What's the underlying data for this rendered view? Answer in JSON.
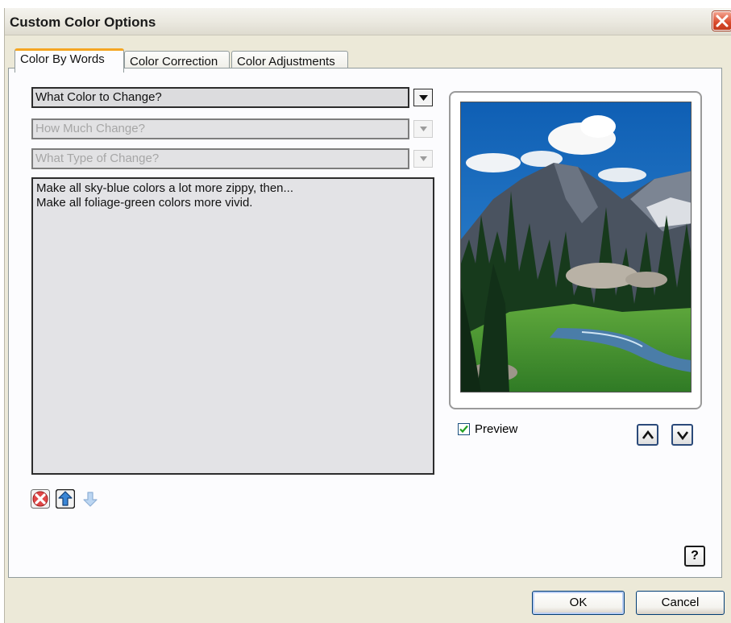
{
  "window": {
    "title": "Custom Color Options"
  },
  "tabs": [
    {
      "label": "Color By Words",
      "active": true
    },
    {
      "label": "Color Correction",
      "active": false
    },
    {
      "label": "Color Adjustments",
      "active": false
    }
  ],
  "combos": {
    "what_color": "What Color to Change?",
    "how_much": "How Much Change?",
    "what_type": "What Type of Change?"
  },
  "instructions": [
    "Make all sky-blue colors a lot more zippy, then...",
    "Make all foliage-green colors more vivid."
  ],
  "list_actions": {
    "delete_icon": "delete-x-icon",
    "move_up_icon": "arrow-up-icon",
    "move_down_icon": "arrow-down-icon"
  },
  "preview": {
    "label": "Preview",
    "checked": true,
    "image_description_icon": "mountain-lake-photo"
  },
  "help": {
    "label": "?"
  },
  "buttons": {
    "ok": "OK",
    "cancel": "Cancel"
  },
  "colors": {
    "tab_highlight": "#f5a623",
    "panel_bg": "#fcfcfe",
    "dialog_bg": "#ece9d8",
    "button_border": "#003c74"
  }
}
